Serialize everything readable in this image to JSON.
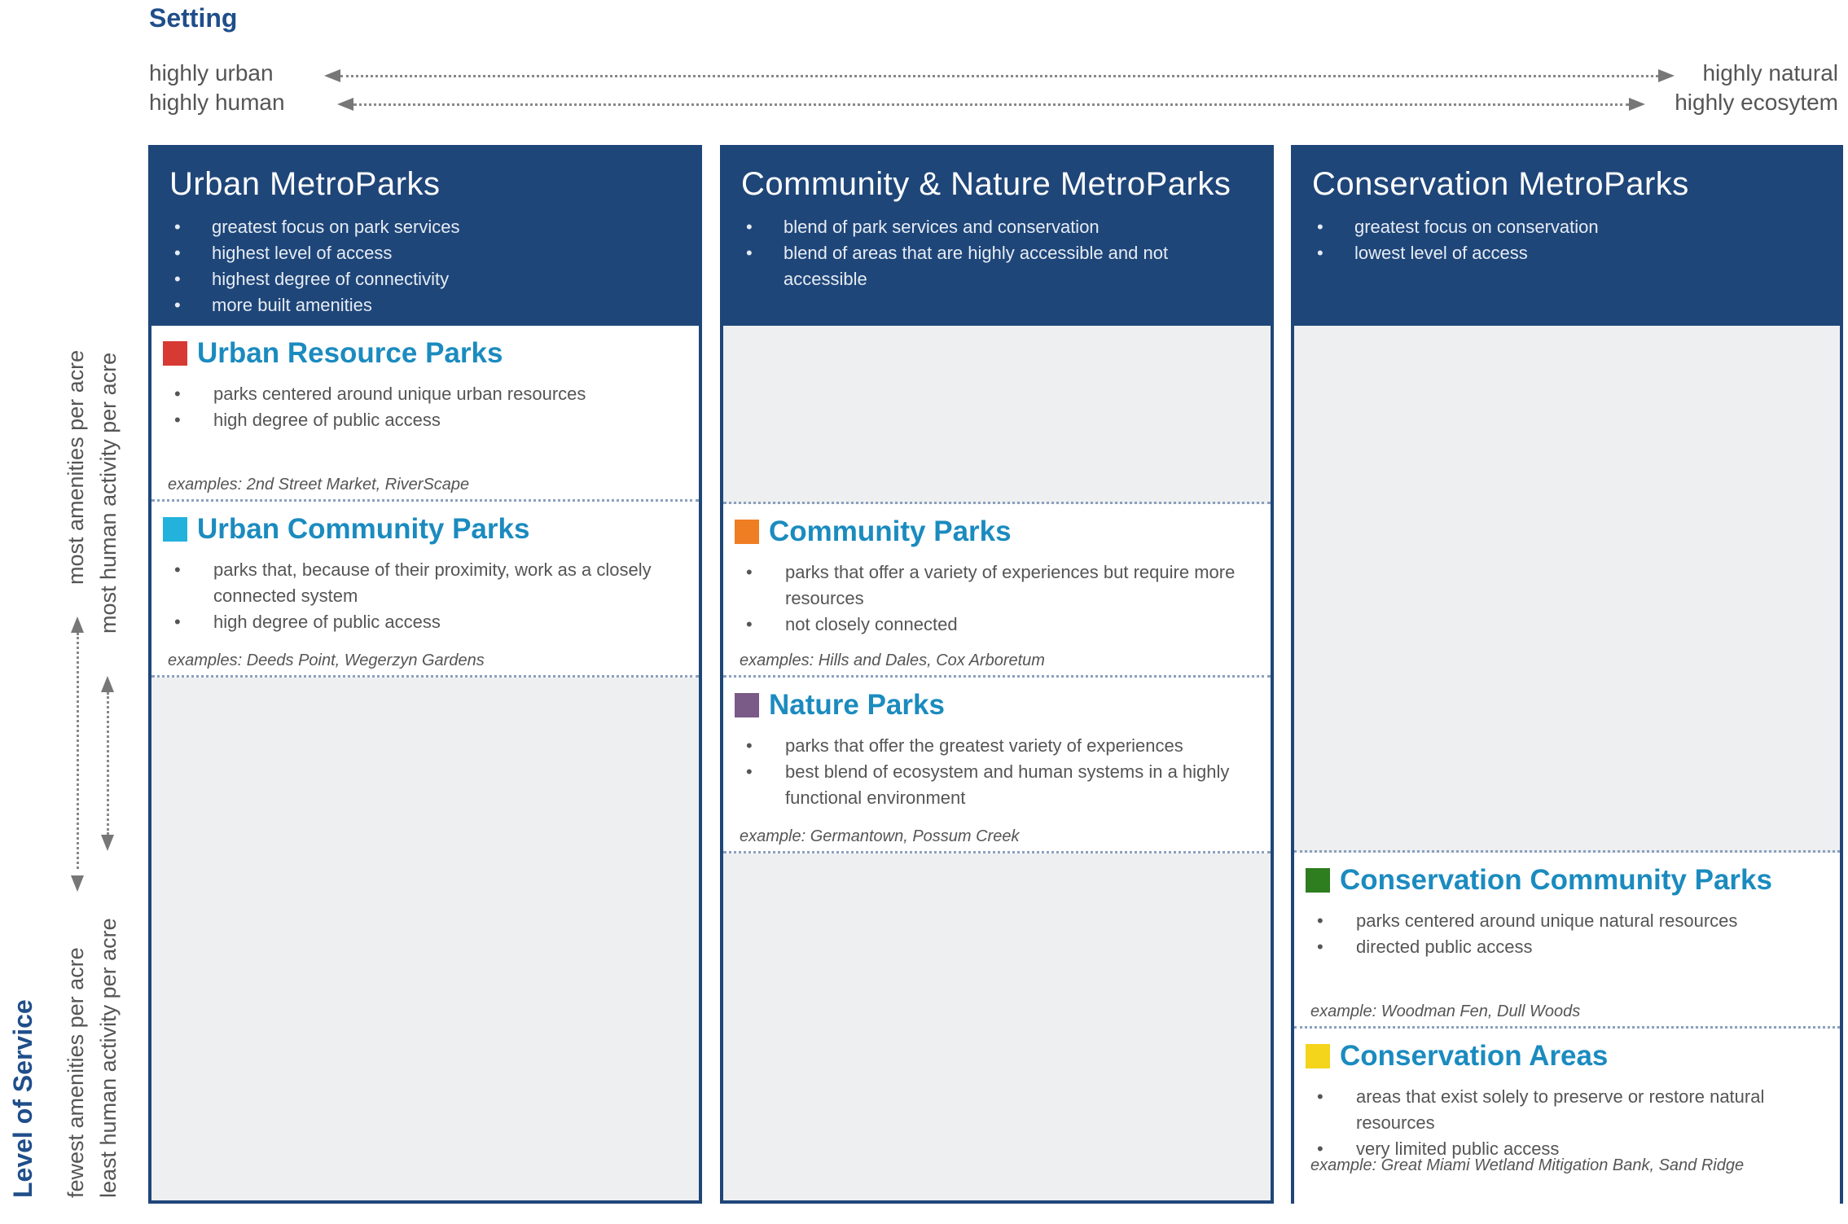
{
  "setting": {
    "title": "Setting",
    "left_label_1": "highly urban",
    "left_label_2": "highly human",
    "right_label_1": "highly natural",
    "right_label_2": "highly ecosytem"
  },
  "level_of_service": {
    "title": "Level of Service",
    "top_1": "most amenities per acre",
    "top_2": "most human activity per acre",
    "bottom_1": "fewest amenities per acre",
    "bottom_2": "least human activity per acre"
  },
  "columns": [
    {
      "title": "Urban MetroParks",
      "bullets": [
        "greatest focus on park services",
        "highest level of access",
        "highest degree of connectivity",
        "more built amenities"
      ]
    },
    {
      "title": "Community & Nature MetroParks",
      "bullets": [
        "blend of park services and conservation",
        "blend of areas that are highly accessible and not accessible"
      ]
    },
    {
      "title": "Conservation MetroParks",
      "bullets": [
        "greatest focus on conservation",
        "lowest level of access"
      ]
    }
  ],
  "cards": {
    "urban_resource": {
      "title": "Urban Resource Parks",
      "color": "#d63a33",
      "bullets": [
        "parks centered around unique urban resources",
        "high degree of public access"
      ],
      "example": "examples: 2nd Street Market, RiverScape"
    },
    "urban_community": {
      "title": "Urban Community Parks",
      "color": "#22b2dc",
      "bullets": [
        "parks that, because of their proximity, work as a closely connected system",
        "high degree of public access"
      ],
      "example": "examples: Deeds Point, Wegerzyn Gardens"
    },
    "community": {
      "title": "Community Parks",
      "color": "#ef7d22",
      "bullets": [
        "parks that offer a variety of experiences but require more resources",
        "not closely connected"
      ],
      "example": "examples: Hills and Dales, Cox Arboretum"
    },
    "nature": {
      "title": "Nature Parks",
      "color": "#7a5b87",
      "bullets": [
        "parks that offer the greatest variety of experiences",
        "best blend of ecosystem and human systems in a highly functional environment"
      ],
      "example": "example: Germantown, Possum Creek"
    },
    "conservation_community": {
      "title": "Conservation Community Parks",
      "color": "#2e7d1f",
      "bullets": [
        "parks centered around unique natural resources",
        "directed public access"
      ],
      "example": "example: Woodman Fen, Dull Woods"
    },
    "conservation_areas": {
      "title": "Conservation Areas",
      "color": "#f4d51b",
      "bullets": [
        "areas that exist solely to preserve or restore natural resources",
        "very limited public access"
      ],
      "example": "example: Great Miami Wetland Mitigation Bank, Sand Ridge"
    }
  }
}
